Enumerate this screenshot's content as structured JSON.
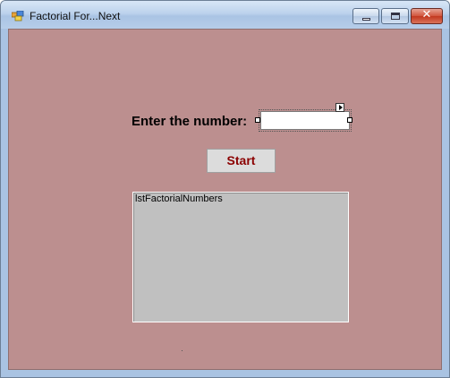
{
  "window": {
    "title": "Factorial For...Next",
    "app_icon": "form-icon",
    "caption_buttons": {
      "minimize": "minimize-icon",
      "maximize": "maximize-icon",
      "close": "close-icon",
      "close_glyph": "✕"
    }
  },
  "form": {
    "background_color": "#bc8f8f",
    "prompt_label": "Enter the number:",
    "number_input_value": "",
    "start_button_label": "Start",
    "start_button_text_color": "#8b0000",
    "list_name": "lstFactorialNumbers",
    "list_background": "#c0c0c0"
  }
}
